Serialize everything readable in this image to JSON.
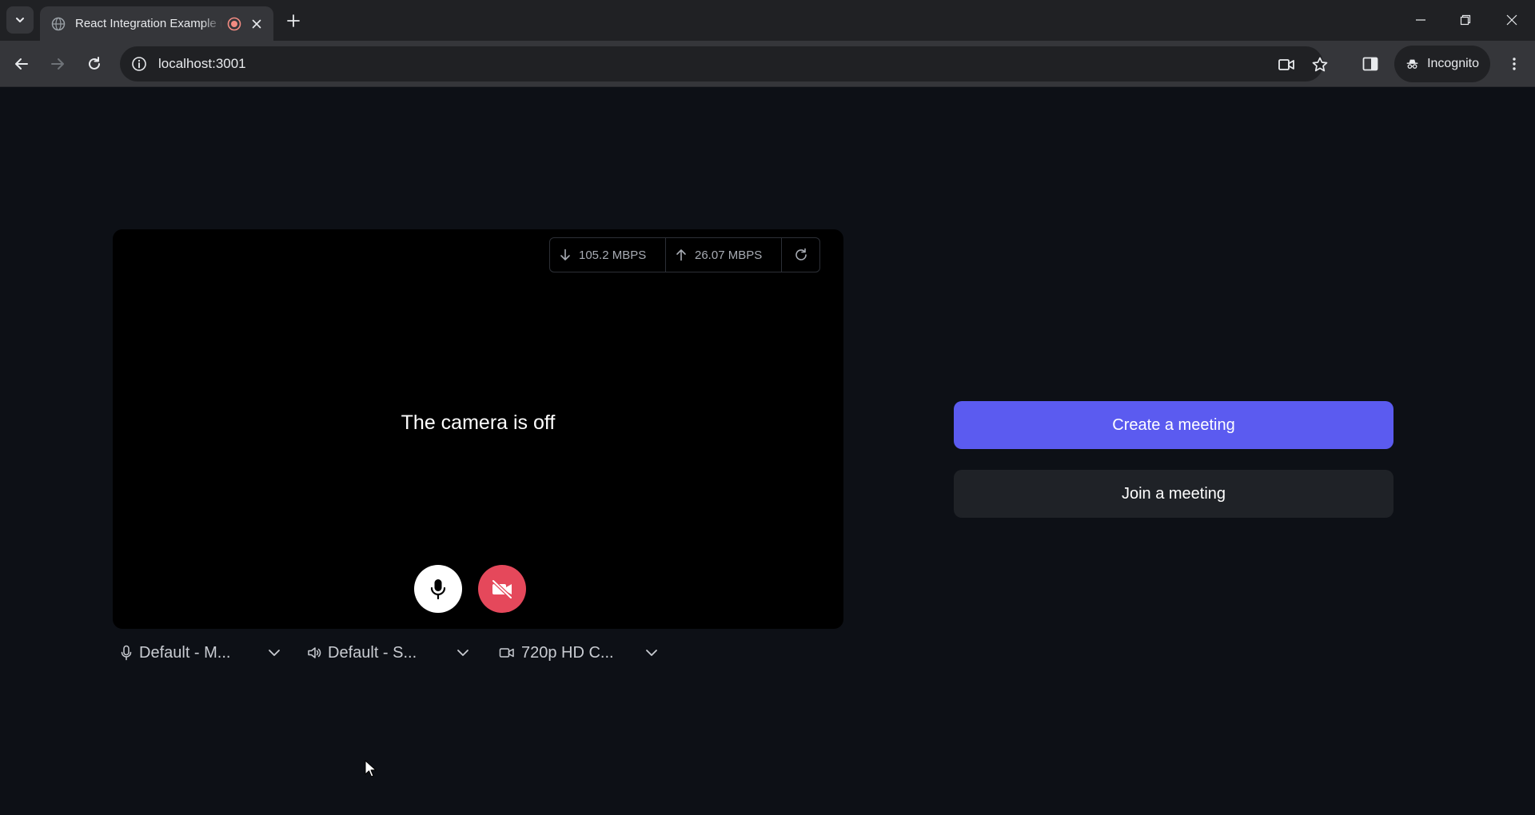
{
  "browser": {
    "tab": {
      "title": "React Integration Example (",
      "favicon": "globe-icon",
      "recording_indicator": "recording-icon",
      "close": "close-icon"
    },
    "new_tab": "plus-icon",
    "window_controls": [
      "minimize-icon",
      "restore-icon",
      "close-icon"
    ],
    "toolbar": {
      "url": "localhost:3001",
      "site_info": "info-icon",
      "right_icons": [
        "video-camera-icon",
        "star-icon",
        "side-panel-icon"
      ],
      "incognito_label": "Incognito",
      "menu": "kebab-menu-icon"
    }
  },
  "preview": {
    "network": {
      "download": "105.2 MBPS",
      "upload": "26.07 MBPS"
    },
    "camera_status": "The camera is off",
    "mic_enabled": true,
    "camera_enabled": false
  },
  "devices": {
    "microphone": "Default - M...",
    "speaker": "Default - S...",
    "camera": "720p HD C..."
  },
  "actions": {
    "create": "Create a meeting",
    "join": "Join a meeting"
  },
  "colors": {
    "primary": "#5b5bf0",
    "camera_off": "#e5485b",
    "secondary_button": "#1f2227",
    "page_background": "#0d1016"
  }
}
